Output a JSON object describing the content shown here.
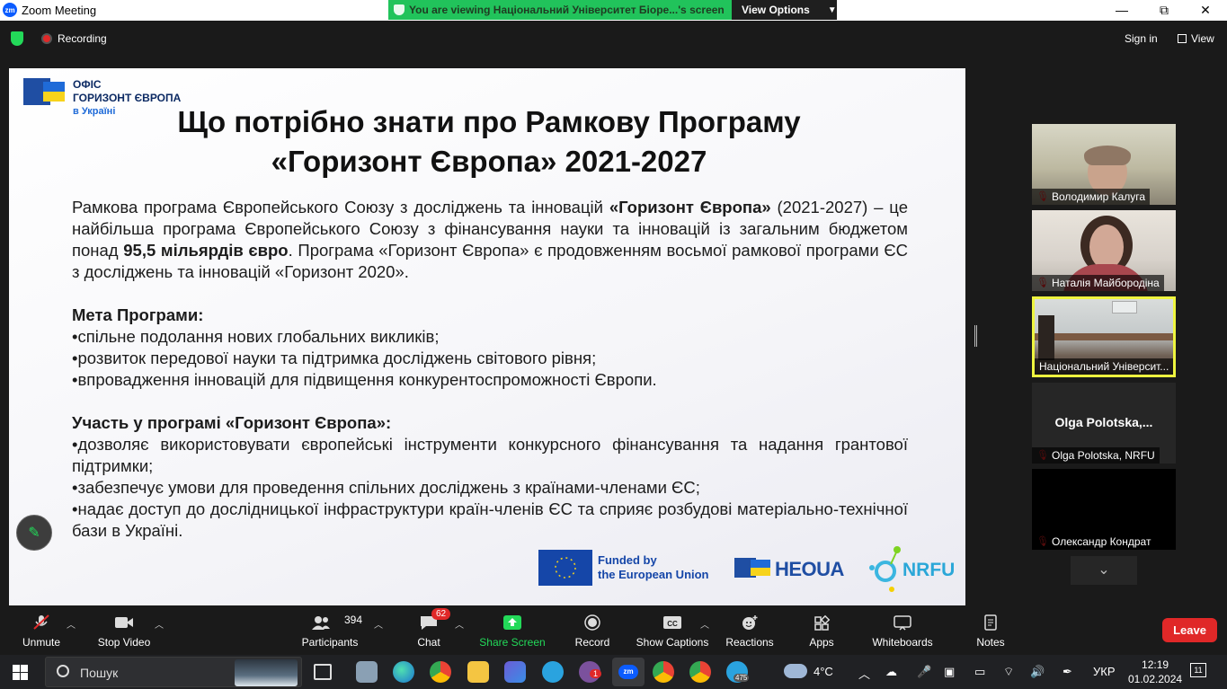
{
  "window": {
    "app_title": "Zoom Meeting",
    "logo_text": "zm",
    "viewing_banner": "You are viewing Національний Університет Біоре...'s screen",
    "view_options_label": "View Options",
    "minimize_glyph": "—",
    "restore_glyph": "⧉",
    "close_glyph": "✕"
  },
  "topbar": {
    "recording_label": "Recording",
    "signin_label": "Sign in",
    "view_label": "View"
  },
  "slide": {
    "logo_line1": "ОФІС",
    "logo_line2": "ГОРИЗОНТ ЄВРОПА",
    "logo_line3": "в Україні",
    "title_line1": "Що потрібно знати про Рамкову Програму",
    "title_line2": "«Горизонт Європа»   2021-2027",
    "intro_part1": "Рамкова програма Європейського Союзу з досліджень та інновацій ",
    "intro_bold1": "«Горизонт Європа»",
    "intro_part2": " (2021-2027) – це найбільша програма Європейського Союзу з фінансування науки та інновацій із загальним бюджетом понад ",
    "intro_bold2": "95,5 мільярдів євро",
    "intro_part3": ". Програма «Горизонт Європа» є продовженням восьмої рамкової програми ЄС з досліджень та інновацій «Горизонт 2020».",
    "goals_heading": "Мета Програми:",
    "goals": [
      "•спільне подолання нових глобальних викликів;",
      "•розвиток передової науки та підтримка досліджень світового рівня;",
      "•впровадження інновацій для підвищення конкурентоспроможності Європи."
    ],
    "participation_heading": "Участь у програмі «Горизонт Європа»:",
    "participation": [
      "•дозволяє використовувати європейські інструменти конкурсного фінансування та надання грантової підтримки;",
      "•забезпечує умови для проведення спільних досліджень з країнами-членами ЄС;",
      "•надає доступ до дослідницької інфраструктури країн-членів ЄС та сприяє розбудові матеріально-технічної бази в Україні."
    ],
    "funded_line1": "Funded by",
    "funded_line2": "the European Union",
    "heoua_label": "HEOUA",
    "nrfu_label": "NRFU"
  },
  "participants_panel": {
    "tiles": [
      {
        "name": "Володимир Калуга"
      },
      {
        "name": "Наталія Майбородіна"
      },
      {
        "name": "Національний Університ..."
      },
      {
        "name": "Olga Polotska, NRFU",
        "big_name": "Olga  Polotska,..."
      },
      {
        "name": "Олександр Кондрат"
      }
    ],
    "scroll_glyph": "⌄"
  },
  "toolbar": {
    "unmute": "Unmute",
    "stop_video": "Stop Video",
    "participants": "Participants",
    "participants_count": "394",
    "chat": "Chat",
    "chat_badge": "62",
    "share_screen": "Share Screen",
    "record": "Record",
    "show_captions": "Show Captions",
    "reactions": "Reactions",
    "apps": "Apps",
    "whiteboards": "Whiteboards",
    "notes": "Notes",
    "leave": "Leave"
  },
  "taskbar": {
    "search_placeholder": "Пошук",
    "temperature": "4°C",
    "language": "УКР",
    "time": "12:19",
    "date": "01.02.2024",
    "notifications_badge": "11",
    "viber_badge": "1",
    "telegram_badge": "475"
  },
  "colors": {
    "zoom_blue": "#0b5cff",
    "banner_green": "#21c35b",
    "leave_red": "#e02828",
    "active_speaker": "#eef53f"
  }
}
